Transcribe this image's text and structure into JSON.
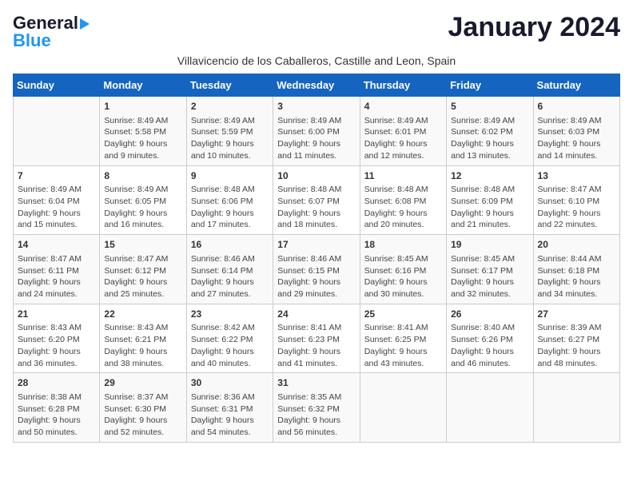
{
  "header": {
    "logo_line1": "General",
    "logo_line2": "Blue",
    "title": "January 2024",
    "subtitle": "Villavicencio de los Caballeros, Castille and Leon, Spain"
  },
  "days_of_week": [
    "Sunday",
    "Monday",
    "Tuesday",
    "Wednesday",
    "Thursday",
    "Friday",
    "Saturday"
  ],
  "weeks": [
    [
      {
        "day": "",
        "content": ""
      },
      {
        "day": "1",
        "content": "Sunrise: 8:49 AM\nSunset: 5:58 PM\nDaylight: 9 hours\nand 9 minutes."
      },
      {
        "day": "2",
        "content": "Sunrise: 8:49 AM\nSunset: 5:59 PM\nDaylight: 9 hours\nand 10 minutes."
      },
      {
        "day": "3",
        "content": "Sunrise: 8:49 AM\nSunset: 6:00 PM\nDaylight: 9 hours\nand 11 minutes."
      },
      {
        "day": "4",
        "content": "Sunrise: 8:49 AM\nSunset: 6:01 PM\nDaylight: 9 hours\nand 12 minutes."
      },
      {
        "day": "5",
        "content": "Sunrise: 8:49 AM\nSunset: 6:02 PM\nDaylight: 9 hours\nand 13 minutes."
      },
      {
        "day": "6",
        "content": "Sunrise: 8:49 AM\nSunset: 6:03 PM\nDaylight: 9 hours\nand 14 minutes."
      }
    ],
    [
      {
        "day": "7",
        "content": "Sunrise: 8:49 AM\nSunset: 6:04 PM\nDaylight: 9 hours\nand 15 minutes."
      },
      {
        "day": "8",
        "content": "Sunrise: 8:49 AM\nSunset: 6:05 PM\nDaylight: 9 hours\nand 16 minutes."
      },
      {
        "day": "9",
        "content": "Sunrise: 8:48 AM\nSunset: 6:06 PM\nDaylight: 9 hours\nand 17 minutes."
      },
      {
        "day": "10",
        "content": "Sunrise: 8:48 AM\nSunset: 6:07 PM\nDaylight: 9 hours\nand 18 minutes."
      },
      {
        "day": "11",
        "content": "Sunrise: 8:48 AM\nSunset: 6:08 PM\nDaylight: 9 hours\nand 20 minutes."
      },
      {
        "day": "12",
        "content": "Sunrise: 8:48 AM\nSunset: 6:09 PM\nDaylight: 9 hours\nand 21 minutes."
      },
      {
        "day": "13",
        "content": "Sunrise: 8:47 AM\nSunset: 6:10 PM\nDaylight: 9 hours\nand 22 minutes."
      }
    ],
    [
      {
        "day": "14",
        "content": "Sunrise: 8:47 AM\nSunset: 6:11 PM\nDaylight: 9 hours\nand 24 minutes."
      },
      {
        "day": "15",
        "content": "Sunrise: 8:47 AM\nSunset: 6:12 PM\nDaylight: 9 hours\nand 25 minutes."
      },
      {
        "day": "16",
        "content": "Sunrise: 8:46 AM\nSunset: 6:14 PM\nDaylight: 9 hours\nand 27 minutes."
      },
      {
        "day": "17",
        "content": "Sunrise: 8:46 AM\nSunset: 6:15 PM\nDaylight: 9 hours\nand 29 minutes."
      },
      {
        "day": "18",
        "content": "Sunrise: 8:45 AM\nSunset: 6:16 PM\nDaylight: 9 hours\nand 30 minutes."
      },
      {
        "day": "19",
        "content": "Sunrise: 8:45 AM\nSunset: 6:17 PM\nDaylight: 9 hours\nand 32 minutes."
      },
      {
        "day": "20",
        "content": "Sunrise: 8:44 AM\nSunset: 6:18 PM\nDaylight: 9 hours\nand 34 minutes."
      }
    ],
    [
      {
        "day": "21",
        "content": "Sunrise: 8:43 AM\nSunset: 6:20 PM\nDaylight: 9 hours\nand 36 minutes."
      },
      {
        "day": "22",
        "content": "Sunrise: 8:43 AM\nSunset: 6:21 PM\nDaylight: 9 hours\nand 38 minutes."
      },
      {
        "day": "23",
        "content": "Sunrise: 8:42 AM\nSunset: 6:22 PM\nDaylight: 9 hours\nand 40 minutes."
      },
      {
        "day": "24",
        "content": "Sunrise: 8:41 AM\nSunset: 6:23 PM\nDaylight: 9 hours\nand 41 minutes."
      },
      {
        "day": "25",
        "content": "Sunrise: 8:41 AM\nSunset: 6:25 PM\nDaylight: 9 hours\nand 43 minutes."
      },
      {
        "day": "26",
        "content": "Sunrise: 8:40 AM\nSunset: 6:26 PM\nDaylight: 9 hours\nand 46 minutes."
      },
      {
        "day": "27",
        "content": "Sunrise: 8:39 AM\nSunset: 6:27 PM\nDaylight: 9 hours\nand 48 minutes."
      }
    ],
    [
      {
        "day": "28",
        "content": "Sunrise: 8:38 AM\nSunset: 6:28 PM\nDaylight: 9 hours\nand 50 minutes."
      },
      {
        "day": "29",
        "content": "Sunrise: 8:37 AM\nSunset: 6:30 PM\nDaylight: 9 hours\nand 52 minutes."
      },
      {
        "day": "30",
        "content": "Sunrise: 8:36 AM\nSunset: 6:31 PM\nDaylight: 9 hours\nand 54 minutes."
      },
      {
        "day": "31",
        "content": "Sunrise: 8:35 AM\nSunset: 6:32 PM\nDaylight: 9 hours\nand 56 minutes."
      },
      {
        "day": "",
        "content": ""
      },
      {
        "day": "",
        "content": ""
      },
      {
        "day": "",
        "content": ""
      }
    ]
  ]
}
